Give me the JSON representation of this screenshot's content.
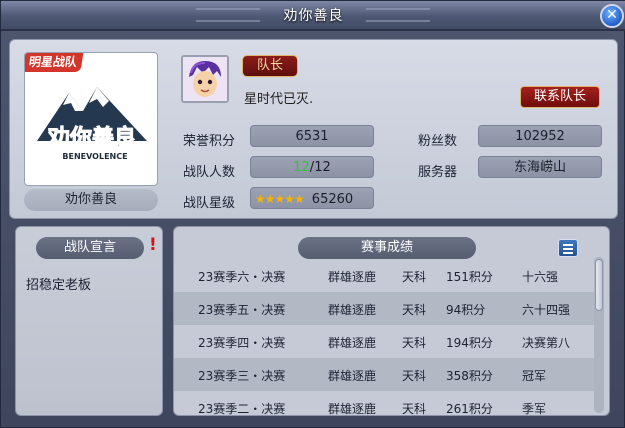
{
  "window": {
    "title": "劝你善良"
  },
  "team": {
    "tag": "明星战队",
    "logo_text": "劝你善良",
    "logo_subtext": "BENEVOLENCE",
    "name": "劝你善良",
    "captain_badge": "队长",
    "motto": "星时代已灭.",
    "contact_button": "联系队长"
  },
  "stats": {
    "honor_label": "荣誉积分",
    "honor_value": "6531",
    "fans_label": "粉丝数",
    "fans_value": "102952",
    "members_label": "战队人数",
    "members_current": "12",
    "members_sep": "/",
    "members_max": "12",
    "server_label": "服务器",
    "server_value": "东海崂山",
    "star_label": "战队星级",
    "star_icons": "★★★★★",
    "star_value": "65260"
  },
  "declaration": {
    "title": "战队宣言",
    "alert": "!",
    "text": "招稳定老板"
  },
  "records": {
    "title": "赛事成绩",
    "rows": [
      [
        "23赛季六・决赛",
        "群雄逐鹿",
        "天科",
        "151积分",
        "十六强"
      ],
      [
        "23赛季五・决赛",
        "群雄逐鹿",
        "天科",
        "94积分",
        "六十四强"
      ],
      [
        "23赛季四・决赛",
        "群雄逐鹿",
        "天科",
        "194积分",
        "决赛第八"
      ],
      [
        "23赛季三・决赛",
        "群雄逐鹿",
        "天科",
        "358积分",
        "冠军"
      ],
      [
        "23赛季二・决赛",
        "群雄逐鹿",
        "天科",
        "261积分",
        "季军"
      ]
    ]
  },
  "colors": {
    "accent_red": "#8b1d1a",
    "highlight_green": "#2fc43a",
    "close_blue": "#2260c8"
  },
  "icons": {
    "close": "close-icon",
    "menu": "menu-icon",
    "alert": "exclamation-icon",
    "star": "star-icon"
  }
}
